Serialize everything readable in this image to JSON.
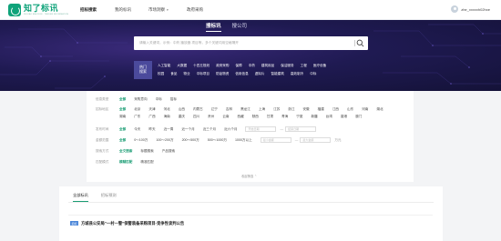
{
  "logo": {
    "name": "知了标讯",
    "sub": "ZHILIAO BIAOXUN · TENDER INFORMATION"
  },
  "nav": {
    "items": [
      {
        "label": "招标搜索",
        "active": true
      },
      {
        "label": "我的标讯",
        "active": false
      },
      {
        "label": "市场洞察",
        "active": false,
        "dropdown": true
      },
      {
        "label": "政府采购",
        "active": false
      }
    ]
  },
  "user": {
    "name": "zhe_xxxxxh02hxe"
  },
  "search": {
    "tabs": [
      {
        "label": "搜标讯",
        "active": true
      },
      {
        "label": "搜公司",
        "active": false
      }
    ],
    "placeholder": "请输入关键词，示例：中药 播放器 项目等，多个关键词用空格隔开"
  },
  "hot": {
    "label_line1": "热门",
    "label_line2": "搜索",
    "rows": [
      [
        "人工智能",
        "大数据",
        "十四五规划",
        "政府采购",
        "保障",
        "中药",
        "建筑用品",
        "保洁服务",
        "工程",
        "医疗设备"
      ],
      [
        "校园",
        "食品",
        "物业",
        "中标项目",
        "防疫物资",
        "信用信息",
        "虚拟片",
        "智能建筑",
        "高效制冷",
        "中标"
      ]
    ]
  },
  "filters": {
    "rows": [
      {
        "label": "信息类型",
        "options": [
          "全部",
          "采购意向",
          "中标",
          "招标"
        ]
      },
      {
        "label": "招标地区",
        "options": [
          "全部",
          "北京",
          "天津",
          "河北",
          "山西",
          "内蒙古",
          "辽宁",
          "吉林",
          "黑龙江",
          "上海",
          "江苏",
          "浙江",
          "安徽",
          "福建",
          "江西",
          "山东",
          "河南",
          "湖北",
          "湖南",
          "广东",
          "广西",
          "海南",
          "重庆",
          "四川",
          "贵州",
          "云南",
          "西藏",
          "陕西",
          "甘肃",
          "青海",
          "宁夏",
          "新疆",
          "台湾",
          "香港",
          "澳门"
        ]
      },
      {
        "label": "发布时间",
        "options": [
          "全部",
          "今天",
          "昨天",
          "近一周",
          "近一个月",
          "近三个月",
          "近六个月"
        ],
        "range": [
          "开始日期",
          "结束日期"
        ]
      },
      {
        "label": "金额范围",
        "options": [
          "全部",
          "0～100万",
          "100～200万",
          "200～500万",
          "500～1000万",
          "1000万以上"
        ],
        "range": [
          "最小金额",
          "最大金额"
        ],
        "unit": "万元"
      },
      {
        "label": "搜索方式",
        "options": [
          "全文搜索",
          "标题搜索",
          "产品搜索"
        ]
      },
      {
        "label": "匹配模式",
        "options": [
          "模糊匹配",
          "精准匹配"
        ]
      }
    ],
    "expand": "收起筛选"
  },
  "results": {
    "tabs": [
      {
        "label": "全部标讯",
        "active": true
      },
      {
        "label": "招标预测",
        "active": false
      }
    ],
    "items": [
      {
        "badge": "招标",
        "title": "方城县公安局“一村一警”保警装备采购项目-竞争性谈判公告"
      }
    ]
  },
  "colors": {
    "accent": "#1b9d74",
    "brand": "#0fa37a",
    "hero": "#1f1a52",
    "badge": "#4a86d9"
  }
}
